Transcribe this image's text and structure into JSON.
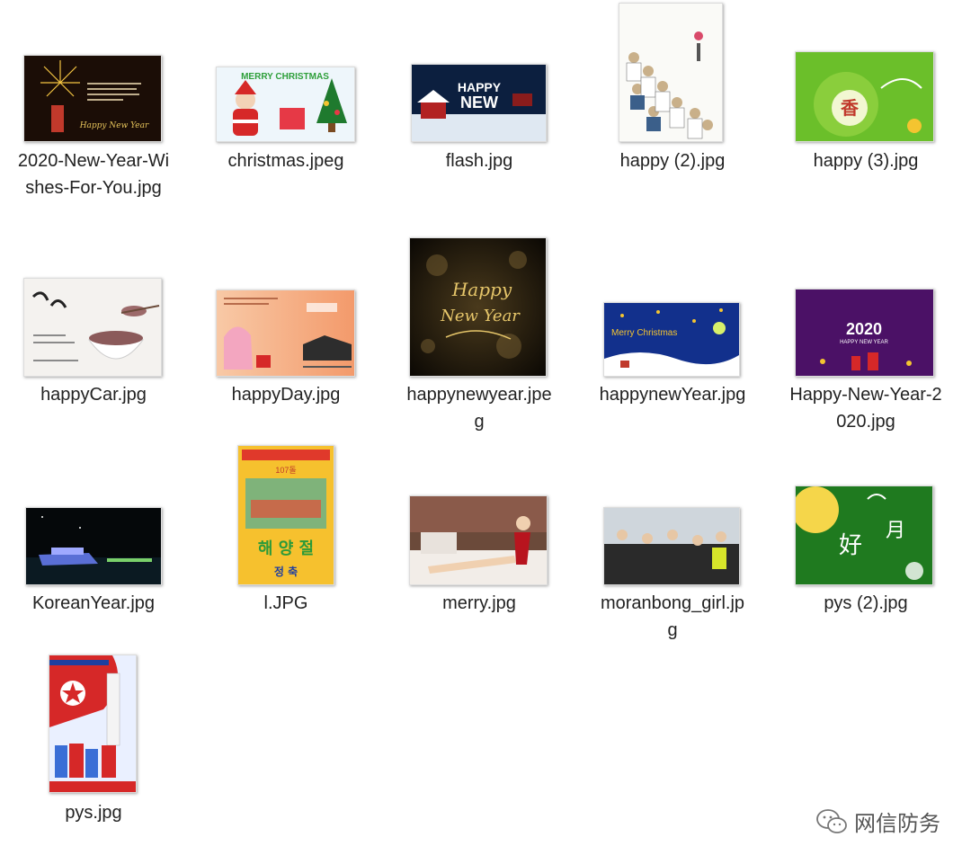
{
  "files": [
    {
      "name": "2020-New-Year-Wishes-For-You.jpg",
      "thumb_icon": "fireworks-card-image"
    },
    {
      "name": "christmas.jpeg",
      "thumb_icon": "santa-christmas-image"
    },
    {
      "name": "flash.jpg",
      "thumb_icon": "happy-new-year-snow-image"
    },
    {
      "name": "happy (2).jpg",
      "thumb_icon": "korean-people-painting-image"
    },
    {
      "name": "happy (3).jpg",
      "thumb_icon": "green-greeting-card-image"
    },
    {
      "name": "happyCar.jpg",
      "thumb_icon": "rice-bowl-image"
    },
    {
      "name": "happyDay.jpg",
      "thumb_icon": "gift-bag-card-image"
    },
    {
      "name": "happynewyear.jpeg",
      "thumb_icon": "golden-happy-new-year-image"
    },
    {
      "name": "happynewYear.jpg",
      "thumb_icon": "merry-christmas-night-image"
    },
    {
      "name": "Happy-New-Year-2020.jpg",
      "thumb_icon": "purple-2020-image"
    },
    {
      "name": "KoreanYear.jpg",
      "thumb_icon": "night-river-boat-image"
    },
    {
      "name": "l.JPG",
      "thumb_icon": "korean-poster-image"
    },
    {
      "name": "merry.jpg",
      "thumb_icon": "woman-on-bed-image"
    },
    {
      "name": "moranbong_girl.jpg",
      "thumb_icon": "crowd-photo-image"
    },
    {
      "name": "pys (2).jpg",
      "thumb_icon": "green-moon-card-image"
    },
    {
      "name": "pys.jpg",
      "thumb_icon": "flag-poster-image"
    }
  ],
  "thumb_text": {
    "christmas_banner": "MERRY CHRISTMAS",
    "flash_line1": "HAPPY",
    "flash_line2": "NEW",
    "golden_line1": "Happy",
    "golden_line2": "New Year",
    "xmas_night": "Merry Christmas",
    "purple_year": "2020",
    "purple_sub": "HAPPY NEW YEAR",
    "fireworks_script": "Happy New Year",
    "green_char": "香",
    "poster_bottom": "해 양 절",
    "poster_small": "정 축",
    "poster_top_num": "107돌",
    "moon_char": "月",
    "moon_char2": "好"
  },
  "watermark": {
    "text": "网信防务",
    "icon": "wechat-icon"
  },
  "colors": {
    "label": "#222222",
    "background": "#ffffff"
  }
}
